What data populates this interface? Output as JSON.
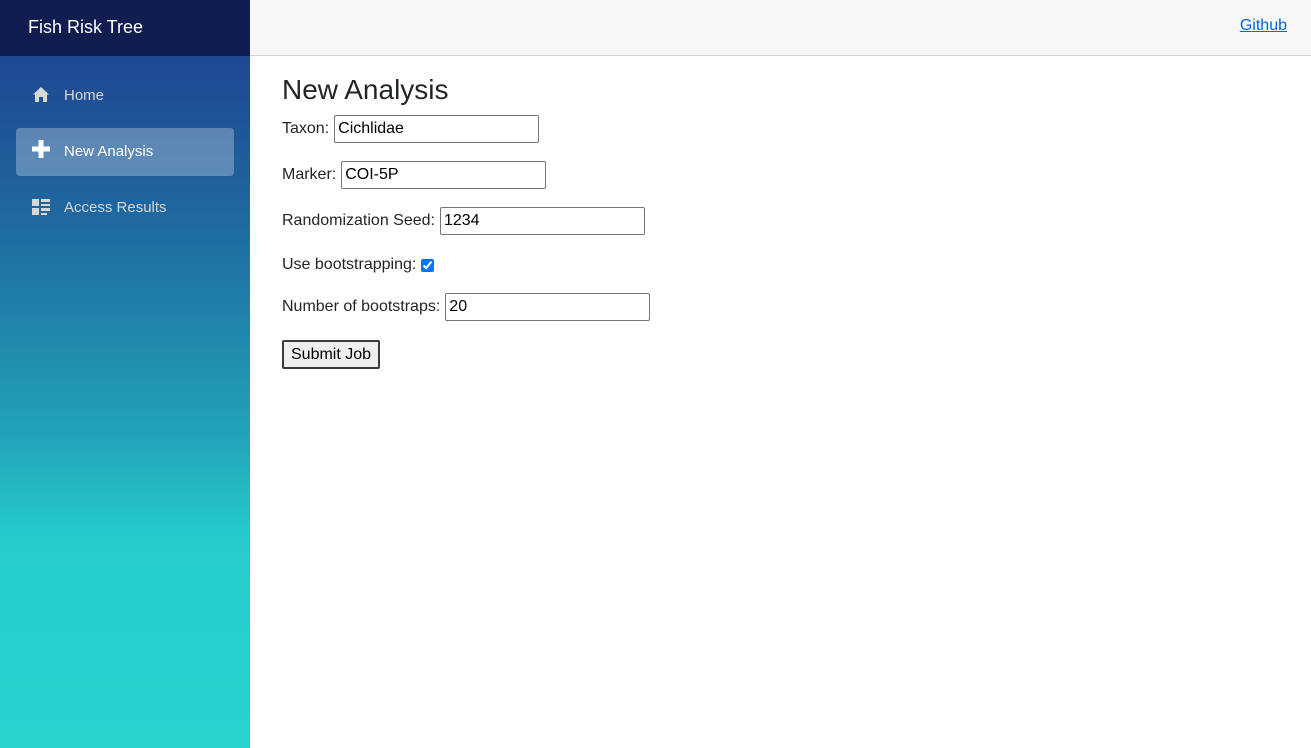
{
  "sidebar": {
    "brand": "Fish Risk Tree",
    "items": [
      {
        "label": "Home",
        "icon": "home-icon",
        "active": false
      },
      {
        "label": "New Analysis",
        "icon": "plus-icon",
        "active": true
      },
      {
        "label": "Access Results",
        "icon": "list-icon",
        "active": false
      }
    ]
  },
  "header": {
    "github_label": "Github"
  },
  "main": {
    "title": "New Analysis",
    "fields": {
      "taxon": {
        "label": "Taxon:",
        "value": "Cichlidae"
      },
      "marker": {
        "label": "Marker:",
        "value": "COI-5P"
      },
      "seed": {
        "label": "Randomization Seed:",
        "value": "1234"
      },
      "bootstrapping": {
        "label": "Use bootstrapping:",
        "checked": true
      },
      "num_bootstraps": {
        "label": "Number of bootstraps:",
        "value": "20"
      }
    },
    "submit_label": "Submit Job"
  },
  "colors": {
    "brand_bar": "#101d4e",
    "link": "#0366d6",
    "checkbox_accent": "#0075ff"
  }
}
